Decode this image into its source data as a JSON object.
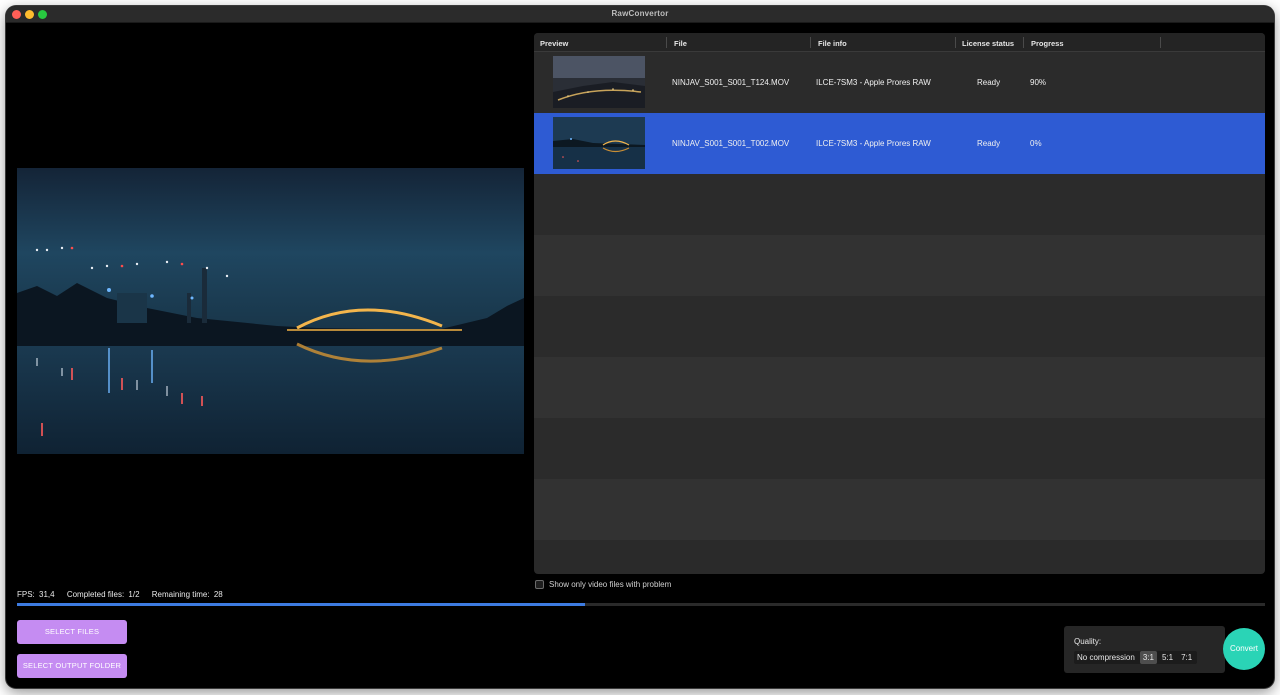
{
  "window": {
    "title": "RawConvertor"
  },
  "table": {
    "headers": {
      "preview": "Preview",
      "file": "File",
      "file_info": "File info",
      "license_status": "License status",
      "progress": "Progress"
    },
    "rows": [
      {
        "file": "NINJAV_S001_S001_T124.MOV",
        "file_info": "ILCE-7SM3 - Apple Prores RAW",
        "license_status": "Ready",
        "progress": "90%",
        "selected": false
      },
      {
        "file": "NINJAV_S001_S001_T002.MOV",
        "file_info": "ILCE-7SM3 - Apple Prores RAW",
        "license_status": "Ready",
        "progress": "0%",
        "selected": true
      }
    ]
  },
  "filters": {
    "show_problem_label": "Show only video files with problem",
    "show_problem_checked": false
  },
  "status": {
    "fps_label": "FPS:",
    "fps_value": "31,4",
    "completed_label": "Completed files:",
    "completed_value": "1/2",
    "remaining_label": "Remaining time:",
    "remaining_value": "28",
    "overall_progress": 0.455
  },
  "buttons": {
    "select_files": "SELECT FILES",
    "select_output": "SELECT OUTPUT FOLDER",
    "convert": "Convert"
  },
  "quality": {
    "label": "Quality:",
    "options": [
      "No compression",
      "3:1",
      "5:1",
      "7:1"
    ],
    "selected": "3:1"
  },
  "colors": {
    "accent_blue": "#2e5bd3",
    "button_purple": "#c58cf2",
    "convert_teal": "#2ad4b6"
  }
}
